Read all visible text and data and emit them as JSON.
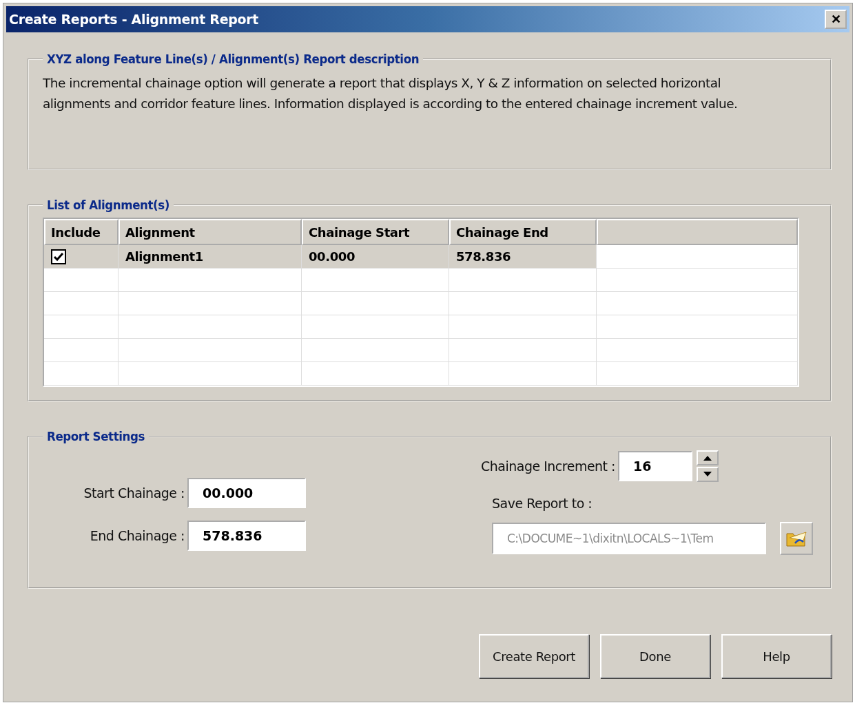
{
  "window": {
    "title": "Create Reports - Alignment Report",
    "close": "✕"
  },
  "description": {
    "legend": "XYZ along Feature Line(s) / Alignment(s) Report description",
    "text": "The incremental chainage option will generate a report that displays X, Y & Z information on selected horizontal alignments and corridor feature lines. Information displayed is according to the entered chainage increment value."
  },
  "alignments": {
    "legend": "List of Alignment(s)",
    "columns": [
      "Include",
      "Alignment",
      "Chainage Start",
      "Chainage End"
    ],
    "rows": [
      {
        "include": true,
        "selected": true,
        "alignment": "Alignment1",
        "chainage_start": "00.000",
        "chainage_end": "578.836"
      }
    ]
  },
  "settings": {
    "legend": "Report Settings",
    "start_label": "Start Chainage :",
    "start_value": "00.000",
    "end_label": "End Chainage :",
    "end_value": "578.836",
    "increment_label": "Chainage Increment :",
    "increment_value": "16",
    "save_label": "Save Report to :",
    "save_path": "C:\\DOCUME~1\\dixitn\\LOCALS~1\\Tem",
    "save_path_disabled": true
  },
  "buttons": [
    "Create Report",
    "Done",
    "Help"
  ]
}
